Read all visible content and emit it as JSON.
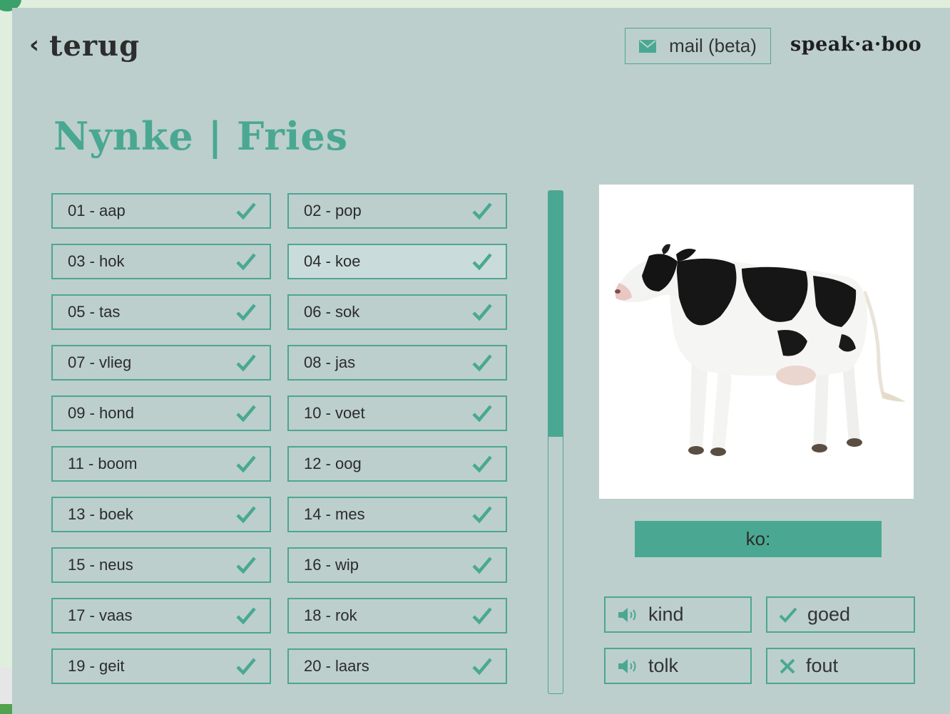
{
  "header": {
    "back_label": "terug",
    "mail_label": "mail (beta)",
    "brand": "speak·a·boo"
  },
  "title": "Nynke | Fries",
  "words": [
    {
      "label": "01 - aap",
      "active": false
    },
    {
      "label": "02 - pop",
      "active": false
    },
    {
      "label": "03 - hok",
      "active": false
    },
    {
      "label": "04 - koe",
      "active": true
    },
    {
      "label": "05 - tas",
      "active": false
    },
    {
      "label": "06 - sok",
      "active": false
    },
    {
      "label": "07 - vlieg",
      "active": false
    },
    {
      "label": "08 - jas",
      "active": false
    },
    {
      "label": "09 - hond",
      "active": false
    },
    {
      "label": "10 - voet",
      "active": false
    },
    {
      "label": "11 - boom",
      "active": false
    },
    {
      "label": "12 - oog",
      "active": false
    },
    {
      "label": "13 - boek",
      "active": false
    },
    {
      "label": "14 - mes",
      "active": false
    },
    {
      "label": "15 - neus",
      "active": false
    },
    {
      "label": "16 - wip",
      "active": false
    },
    {
      "label": "17 - vaas",
      "active": false
    },
    {
      "label": "18 - rok",
      "active": false
    },
    {
      "label": "19 - geit",
      "active": false
    },
    {
      "label": "20 - laars",
      "active": false
    }
  ],
  "scroll_fraction_visible": 0.49,
  "detail": {
    "image": "cow-photo",
    "pronunciation": "ko:",
    "actions": {
      "kind": "kind",
      "tolk": "tolk",
      "goed": "goed",
      "fout": "fout"
    }
  },
  "colors": {
    "accent": "#4aa892",
    "panel": "#bccfcd",
    "text": "#2b2b2b"
  }
}
